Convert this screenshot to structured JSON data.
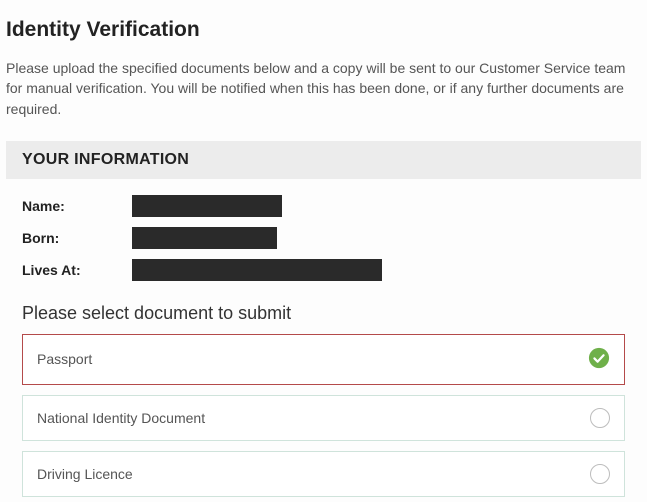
{
  "title": "Identity Verification",
  "intro": "Please upload the specified documents below and a copy will be sent to our Customer Service team for manual verification. You will be notified when this has been done, or if any further documents are required.",
  "info": {
    "header": "YOUR INFORMATION",
    "fields": {
      "name_label": "Name:",
      "born_label": "Born:",
      "lives_at_label": "Lives At:"
    }
  },
  "select_title": "Please select document to submit",
  "options": [
    {
      "label": "Passport",
      "selected": true
    },
    {
      "label": "National Identity Document",
      "selected": false
    },
    {
      "label": "Driving Licence",
      "selected": false
    }
  ]
}
